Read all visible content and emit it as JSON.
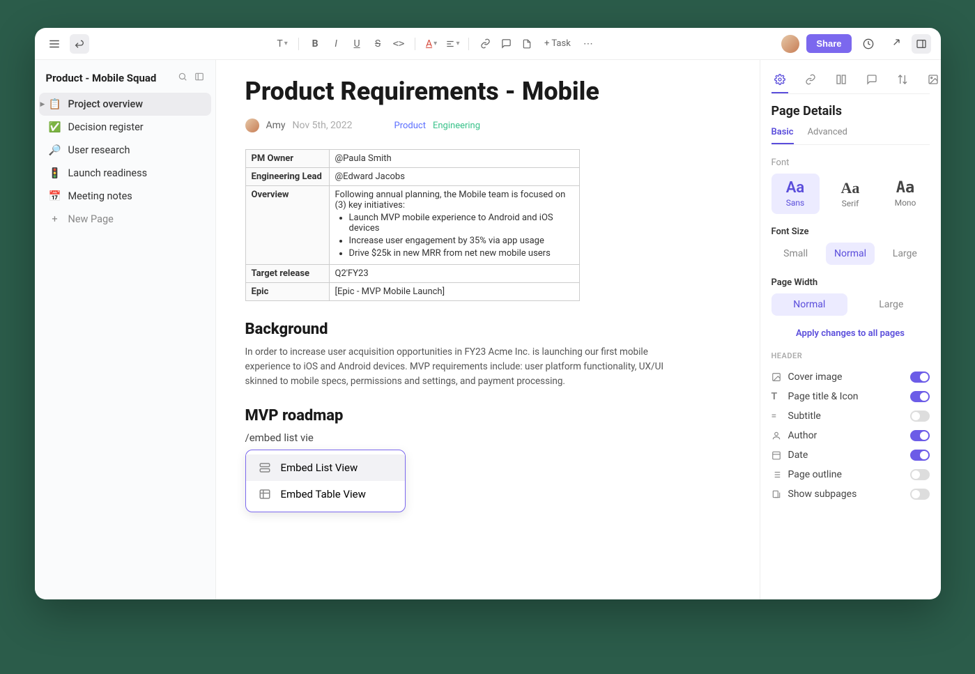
{
  "toolbar": {
    "task_label": "+ Task",
    "share_label": "Share"
  },
  "sidebar": {
    "title": "Product - Mobile Squad",
    "items": [
      {
        "icon": "📋",
        "label": "Project overview"
      },
      {
        "icon": "✅",
        "label": "Decision register"
      },
      {
        "icon": "🔎",
        "label": "User research"
      },
      {
        "icon": "🚦",
        "label": "Launch readiness"
      },
      {
        "icon": "📅",
        "label": "Meeting notes"
      }
    ],
    "new_page": "New Page"
  },
  "page": {
    "title": "Product Requirements - Mobile",
    "author": "Amy",
    "date": "Nov 5th, 2022",
    "tags": {
      "product": "Product",
      "engineering": "Engineering"
    },
    "table": {
      "pm_owner_label": "PM Owner",
      "pm_owner_value": "@Paula Smith",
      "eng_lead_label": "Engineering Lead",
      "eng_lead_value": "@Edward Jacobs",
      "overview_label": "Overview",
      "overview_intro": "Following annual planning, the Mobile team is focused on (3) key initiatives:",
      "overview_bullets": [
        "Launch MVP mobile experience to Android and iOS devices",
        "Increase user engagement by 35% via app usage",
        "Drive $25k in new MRR from net new mobile users"
      ],
      "target_release_label": "Target release",
      "target_release_value": "Q2'FY23",
      "epic_label": "Epic",
      "epic_value": "[Epic - MVP Mobile Launch]"
    },
    "background_heading": "Background",
    "background_body": "In order to increase user acquisition opportunities in FY23 Acme Inc. is launching our first mobile experience to iOS and Android devices. MVP requirements include: user platform functionality, UX/UI skinned to mobile specs, permissions and settings, and payment processing.",
    "roadmap_heading": "MVP roadmap",
    "slash_command": "/embed list vie",
    "embed_options": [
      "Embed List View",
      "Embed Table View"
    ]
  },
  "panel": {
    "title": "Page Details",
    "subtabs": {
      "basic": "Basic",
      "advanced": "Advanced"
    },
    "font_label": "Font",
    "fonts": {
      "sans": "Sans",
      "serif": "Serif",
      "mono": "Mono"
    },
    "font_size_label": "Font Size",
    "sizes": {
      "small": "Small",
      "normal": "Normal",
      "large": "Large"
    },
    "page_width_label": "Page Width",
    "widths": {
      "normal": "Normal",
      "large": "Large"
    },
    "apply_all": "Apply changes to all pages",
    "header_label": "HEADER",
    "toggles": [
      {
        "label": "Cover image",
        "on": true
      },
      {
        "label": "Page title & Icon",
        "on": true
      },
      {
        "label": "Subtitle",
        "on": false
      },
      {
        "label": "Author",
        "on": true
      },
      {
        "label": "Date",
        "on": true
      },
      {
        "label": "Page outline",
        "on": false
      },
      {
        "label": "Show subpages",
        "on": false
      }
    ]
  }
}
